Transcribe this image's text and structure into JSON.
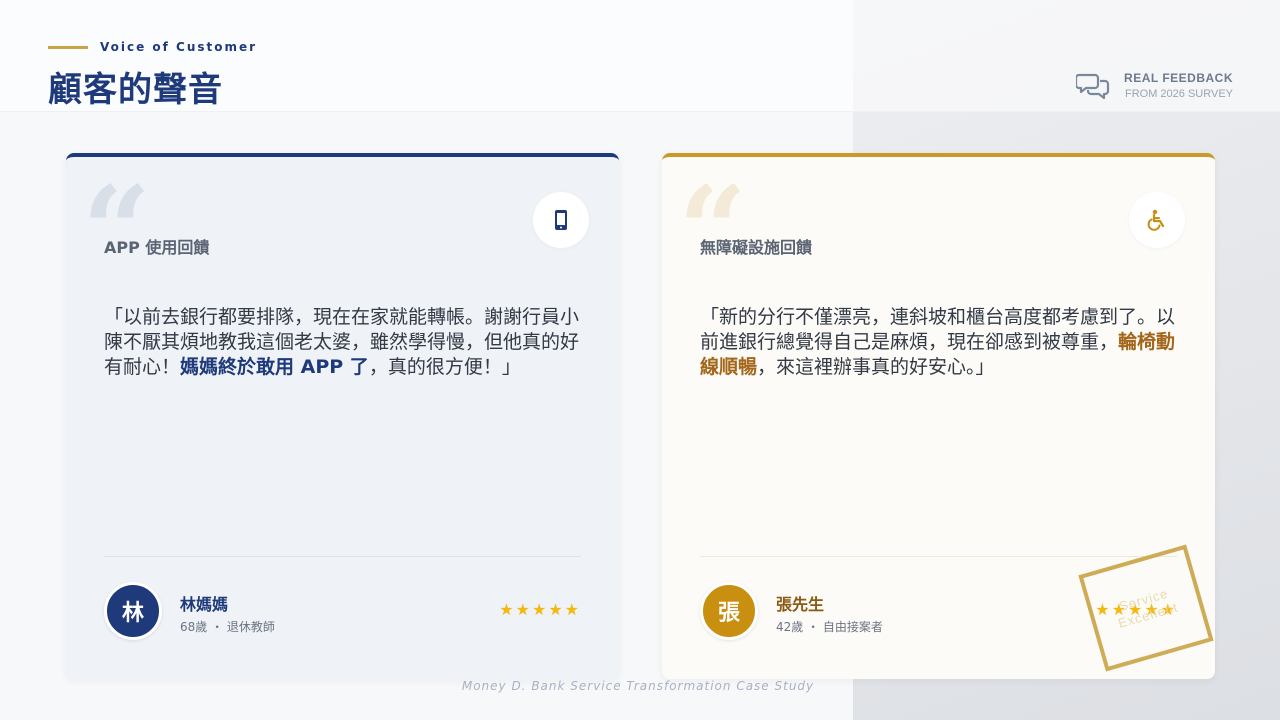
{
  "header": {
    "eyebrow": "Voice of Customer",
    "title": "顧客的聲音",
    "badge_title": "REAL FEEDBACK",
    "badge_subtitle": "FROM 2026 SURVEY",
    "badge_icon": "chat-bubbles-icon"
  },
  "cards": [
    {
      "label": "APP 使用回饋",
      "icon": "smartphone-icon",
      "quote_before": "「以前去銀行都要排隊，現在在家就能轉帳。謝謝行員小陳不厭其煩地教我這個老太婆，雖然學得慢，但他真的好有耐心！",
      "quote_highlight": "媽媽終於敢用 APP 了",
      "quote_after": "，真的很方便！」",
      "avatar_char": "林",
      "name": "林媽媽",
      "meta": "68歲 ・ 退休教師",
      "rating": 5,
      "accent": "#1e3a7b"
    },
    {
      "label": "無障礙設施回饋",
      "icon": "wheelchair-icon",
      "quote_before": "「新的分行不僅漂亮，連斜坡和櫃台高度都考慮到了。以前進銀行總覺得自己是麻煩，現在卻感到被尊重，",
      "quote_highlight": "輪椅動線順暢",
      "quote_after": "，來這裡辦事真的好安心。」",
      "avatar_char": "張",
      "name": "張先生",
      "meta": "42歲 ・ 自由接案者",
      "rating": 5,
      "accent": "#c99a2a"
    }
  ],
  "stamp": {
    "line1": "Service",
    "line2": "Excellent"
  },
  "footer": "Money D. Bank Service Transformation Case Study"
}
